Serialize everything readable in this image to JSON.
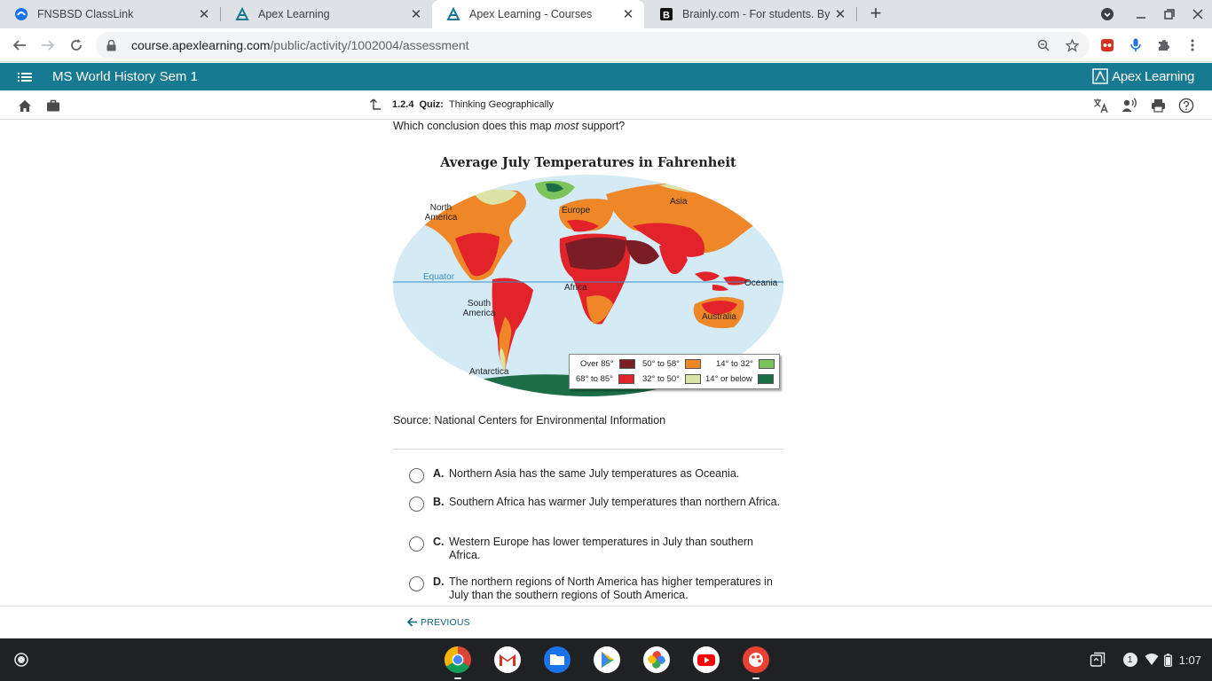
{
  "browser": {
    "tabs": [
      {
        "title": "FNSBSD ClassLink",
        "icon": "classlink-icon",
        "active": false
      },
      {
        "title": "Apex Learning",
        "icon": "apex-icon",
        "active": false
      },
      {
        "title": "Apex Learning - Courses",
        "icon": "apex-icon",
        "active": true
      },
      {
        "title": "Brainly.com - For students. By st",
        "icon": "brainly-icon",
        "active": false
      }
    ],
    "url_host": "course.apexlearning.com",
    "url_path": "/public/activity/1002004/assessment"
  },
  "apex": {
    "course_title": "MS World History Sem 1",
    "logo_text": "Apex Learning",
    "activity_number": "1.2.4",
    "activity_kind": "Quiz:",
    "activity_title": "Thinking Geographically"
  },
  "question": {
    "prefix": "Which conclusion does this map ",
    "emphasis": "most",
    "suffix": " support?"
  },
  "map": {
    "title": "Average July Temperatures in Fahrenheit",
    "labels": {
      "north_america": "North America",
      "europe": "Europe",
      "asia": "Asia",
      "equator": "Equator",
      "africa": "Africa",
      "oceania": "Oceania",
      "south_america": "South America",
      "australia": "Australia",
      "antarctica": "Antarctica"
    },
    "legend": [
      {
        "label": "Over 85°",
        "color": "#7a1d25"
      },
      {
        "label": "68° to 85°",
        "color": "#e3232a"
      },
      {
        "label": "50° to 58°",
        "color": "#ef8627"
      },
      {
        "label": "32° to 50°",
        "color": "#dbe3a6"
      },
      {
        "label": "14° to 32°",
        "color": "#7dc35d"
      },
      {
        "label": "14° or below",
        "color": "#1b6e45"
      }
    ],
    "ocean_color": "#d4eaf5",
    "equator_color": "#3d8ec4"
  },
  "source": "Source: National Centers for Environmental Information",
  "choices": [
    {
      "letter": "A.",
      "text": "Northern Asia has the same July temperatures as Oceania."
    },
    {
      "letter": "B.",
      "text": "Southern Africa has warmer July temperatures than northern Africa."
    },
    {
      "letter": "C.",
      "text": "Western Europe has lower temperatures in July than southern Africa."
    },
    {
      "letter": "D.",
      "text": "The northern regions of North America has higher temperatures in July than the southern regions of South America."
    }
  ],
  "nav": {
    "previous": "PREVIOUS"
  },
  "shelf": {
    "apps": [
      "chrome-icon",
      "gmail-icon",
      "files-icon",
      "play-store-icon",
      "photos-icon",
      "youtube-icon",
      "art-icon"
    ],
    "notification_count": "1",
    "time": "1:07"
  },
  "colors": {
    "apex_teal": "#167b92",
    "link": "#13627a"
  }
}
